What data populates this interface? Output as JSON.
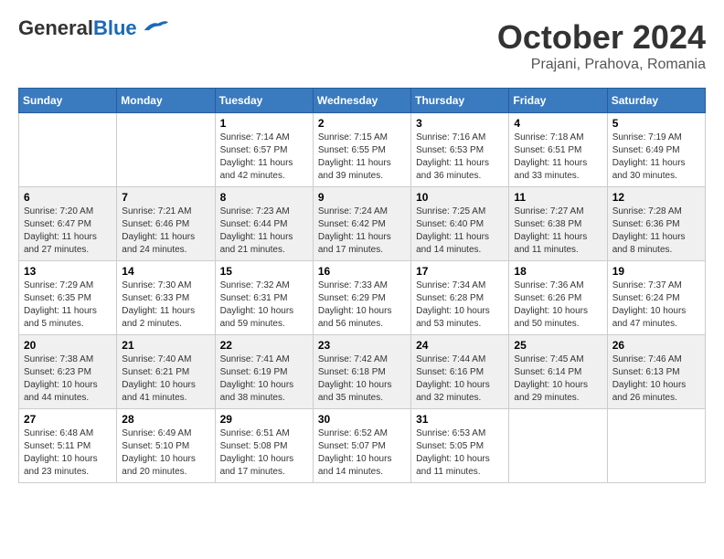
{
  "header": {
    "logo_general": "General",
    "logo_blue": "Blue",
    "month": "October 2024",
    "location": "Prajani, Prahova, Romania"
  },
  "weekdays": [
    "Sunday",
    "Monday",
    "Tuesday",
    "Wednesday",
    "Thursday",
    "Friday",
    "Saturday"
  ],
  "weeks": [
    [
      {
        "day": "",
        "sunrise": "",
        "sunset": "",
        "daylight": ""
      },
      {
        "day": "",
        "sunrise": "",
        "sunset": "",
        "daylight": ""
      },
      {
        "day": "1",
        "sunrise": "Sunrise: 7:14 AM",
        "sunset": "Sunset: 6:57 PM",
        "daylight": "Daylight: 11 hours and 42 minutes."
      },
      {
        "day": "2",
        "sunrise": "Sunrise: 7:15 AM",
        "sunset": "Sunset: 6:55 PM",
        "daylight": "Daylight: 11 hours and 39 minutes."
      },
      {
        "day": "3",
        "sunrise": "Sunrise: 7:16 AM",
        "sunset": "Sunset: 6:53 PM",
        "daylight": "Daylight: 11 hours and 36 minutes."
      },
      {
        "day": "4",
        "sunrise": "Sunrise: 7:18 AM",
        "sunset": "Sunset: 6:51 PM",
        "daylight": "Daylight: 11 hours and 33 minutes."
      },
      {
        "day": "5",
        "sunrise": "Sunrise: 7:19 AM",
        "sunset": "Sunset: 6:49 PM",
        "daylight": "Daylight: 11 hours and 30 minutes."
      }
    ],
    [
      {
        "day": "6",
        "sunrise": "Sunrise: 7:20 AM",
        "sunset": "Sunset: 6:47 PM",
        "daylight": "Daylight: 11 hours and 27 minutes."
      },
      {
        "day": "7",
        "sunrise": "Sunrise: 7:21 AM",
        "sunset": "Sunset: 6:46 PM",
        "daylight": "Daylight: 11 hours and 24 minutes."
      },
      {
        "day": "8",
        "sunrise": "Sunrise: 7:23 AM",
        "sunset": "Sunset: 6:44 PM",
        "daylight": "Daylight: 11 hours and 21 minutes."
      },
      {
        "day": "9",
        "sunrise": "Sunrise: 7:24 AM",
        "sunset": "Sunset: 6:42 PM",
        "daylight": "Daylight: 11 hours and 17 minutes."
      },
      {
        "day": "10",
        "sunrise": "Sunrise: 7:25 AM",
        "sunset": "Sunset: 6:40 PM",
        "daylight": "Daylight: 11 hours and 14 minutes."
      },
      {
        "day": "11",
        "sunrise": "Sunrise: 7:27 AM",
        "sunset": "Sunset: 6:38 PM",
        "daylight": "Daylight: 11 hours and 11 minutes."
      },
      {
        "day": "12",
        "sunrise": "Sunrise: 7:28 AM",
        "sunset": "Sunset: 6:36 PM",
        "daylight": "Daylight: 11 hours and 8 minutes."
      }
    ],
    [
      {
        "day": "13",
        "sunrise": "Sunrise: 7:29 AM",
        "sunset": "Sunset: 6:35 PM",
        "daylight": "Daylight: 11 hours and 5 minutes."
      },
      {
        "day": "14",
        "sunrise": "Sunrise: 7:30 AM",
        "sunset": "Sunset: 6:33 PM",
        "daylight": "Daylight: 11 hours and 2 minutes."
      },
      {
        "day": "15",
        "sunrise": "Sunrise: 7:32 AM",
        "sunset": "Sunset: 6:31 PM",
        "daylight": "Daylight: 10 hours and 59 minutes."
      },
      {
        "day": "16",
        "sunrise": "Sunrise: 7:33 AM",
        "sunset": "Sunset: 6:29 PM",
        "daylight": "Daylight: 10 hours and 56 minutes."
      },
      {
        "day": "17",
        "sunrise": "Sunrise: 7:34 AM",
        "sunset": "Sunset: 6:28 PM",
        "daylight": "Daylight: 10 hours and 53 minutes."
      },
      {
        "day": "18",
        "sunrise": "Sunrise: 7:36 AM",
        "sunset": "Sunset: 6:26 PM",
        "daylight": "Daylight: 10 hours and 50 minutes."
      },
      {
        "day": "19",
        "sunrise": "Sunrise: 7:37 AM",
        "sunset": "Sunset: 6:24 PM",
        "daylight": "Daylight: 10 hours and 47 minutes."
      }
    ],
    [
      {
        "day": "20",
        "sunrise": "Sunrise: 7:38 AM",
        "sunset": "Sunset: 6:23 PM",
        "daylight": "Daylight: 10 hours and 44 minutes."
      },
      {
        "day": "21",
        "sunrise": "Sunrise: 7:40 AM",
        "sunset": "Sunset: 6:21 PM",
        "daylight": "Daylight: 10 hours and 41 minutes."
      },
      {
        "day": "22",
        "sunrise": "Sunrise: 7:41 AM",
        "sunset": "Sunset: 6:19 PM",
        "daylight": "Daylight: 10 hours and 38 minutes."
      },
      {
        "day": "23",
        "sunrise": "Sunrise: 7:42 AM",
        "sunset": "Sunset: 6:18 PM",
        "daylight": "Daylight: 10 hours and 35 minutes."
      },
      {
        "day": "24",
        "sunrise": "Sunrise: 7:44 AM",
        "sunset": "Sunset: 6:16 PM",
        "daylight": "Daylight: 10 hours and 32 minutes."
      },
      {
        "day": "25",
        "sunrise": "Sunrise: 7:45 AM",
        "sunset": "Sunset: 6:14 PM",
        "daylight": "Daylight: 10 hours and 29 minutes."
      },
      {
        "day": "26",
        "sunrise": "Sunrise: 7:46 AM",
        "sunset": "Sunset: 6:13 PM",
        "daylight": "Daylight: 10 hours and 26 minutes."
      }
    ],
    [
      {
        "day": "27",
        "sunrise": "Sunrise: 6:48 AM",
        "sunset": "Sunset: 5:11 PM",
        "daylight": "Daylight: 10 hours and 23 minutes."
      },
      {
        "day": "28",
        "sunrise": "Sunrise: 6:49 AM",
        "sunset": "Sunset: 5:10 PM",
        "daylight": "Daylight: 10 hours and 20 minutes."
      },
      {
        "day": "29",
        "sunrise": "Sunrise: 6:51 AM",
        "sunset": "Sunset: 5:08 PM",
        "daylight": "Daylight: 10 hours and 17 minutes."
      },
      {
        "day": "30",
        "sunrise": "Sunrise: 6:52 AM",
        "sunset": "Sunset: 5:07 PM",
        "daylight": "Daylight: 10 hours and 14 minutes."
      },
      {
        "day": "31",
        "sunrise": "Sunrise: 6:53 AM",
        "sunset": "Sunset: 5:05 PM",
        "daylight": "Daylight: 10 hours and 11 minutes."
      },
      {
        "day": "",
        "sunrise": "",
        "sunset": "",
        "daylight": ""
      },
      {
        "day": "",
        "sunrise": "",
        "sunset": "",
        "daylight": ""
      }
    ]
  ]
}
